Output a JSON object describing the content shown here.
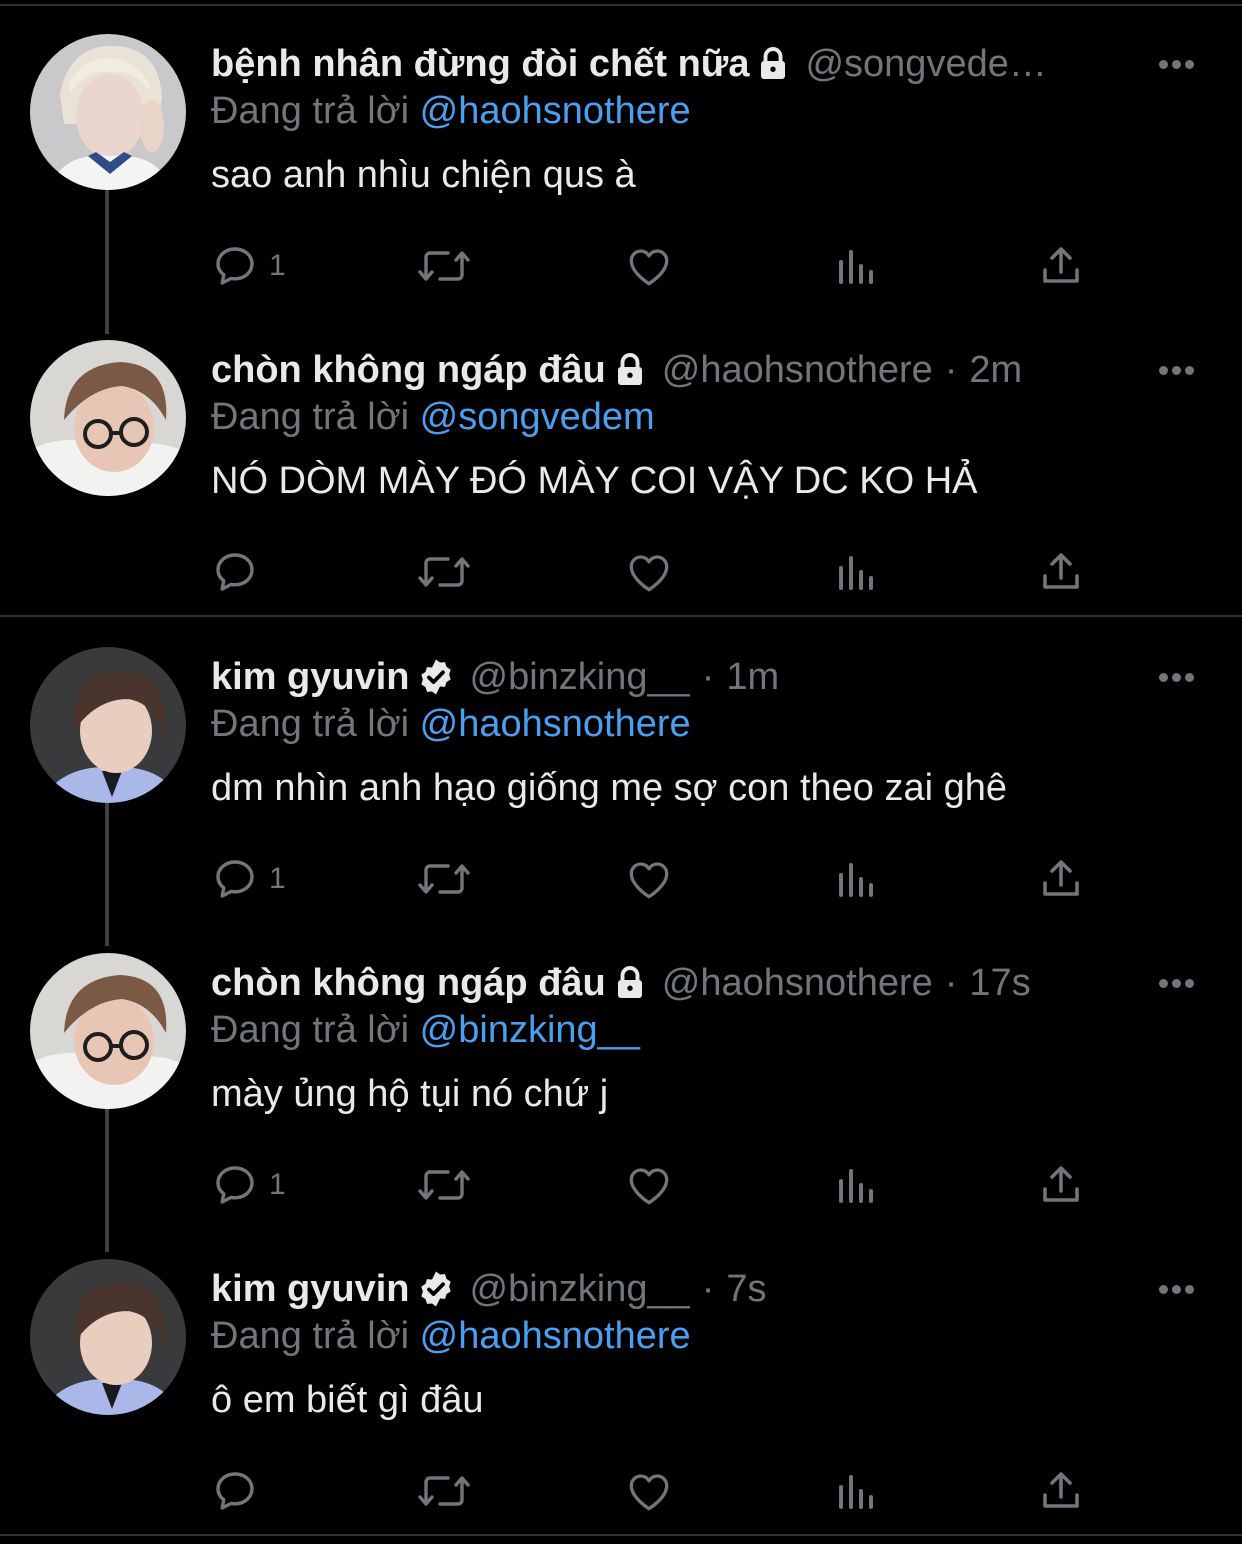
{
  "colors": {
    "background": "#000000",
    "text": "#e7e9ea",
    "secondary": "#71767b",
    "mention": "#4a9ff0",
    "divider": "#2f3336"
  },
  "reply_prefix": "Đang trả lời",
  "tweets": [
    {
      "name": "bệnh nhân đừng đòi chết nữa",
      "badge": "lock-icon",
      "handle": "@songvede…",
      "time": "",
      "replying_to": "@haohsnothere",
      "text": "sao anh nhìu chiện qus à",
      "reply_count": "1"
    },
    {
      "name": "chòn không ngáp đâu",
      "badge": "lock-icon",
      "handle": "@haohsnothere",
      "time": "2m",
      "replying_to": "@songvedem",
      "text": "NÓ DÒM MÀY ĐÓ MÀY COI VẬY DC KO HẢ",
      "reply_count": ""
    },
    {
      "name": "kim gyuvin",
      "badge": "verified-icon",
      "handle": "@binzking__",
      "time": "1m",
      "replying_to": "@haohsnothere",
      "text": "dm nhìn anh hạo giống mẹ sợ con theo zai ghê",
      "reply_count": "1"
    },
    {
      "name": "chòn không ngáp đâu",
      "badge": "lock-icon",
      "handle": "@haohsnothere",
      "time": "17s",
      "replying_to": "@binzking__",
      "text": "mày ủng hộ tụi nó chứ j",
      "reply_count": "1"
    },
    {
      "name": "kim gyuvin",
      "badge": "verified-icon",
      "handle": "@binzking__",
      "time": "7s",
      "replying_to": "@haohsnothere",
      "text": "ô em biết gì đâu",
      "reply_count": ""
    }
  ]
}
